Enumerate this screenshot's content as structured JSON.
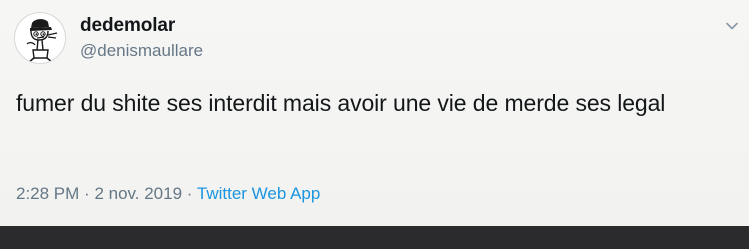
{
  "tweet": {
    "author": {
      "display_name": "dedemolar",
      "handle": "@denismaullare"
    },
    "text": "fumer du shite ses interdit mais avoir une vie de merde ses legal",
    "time": "2:28 PM",
    "separator": "·",
    "date": "2 nov. 2019",
    "source": "Twitter Web App",
    "menu_icon": "chevron-down-icon"
  },
  "colors": {
    "background": "#f4f4f2",
    "text": "#14171a",
    "secondary_text": "#657786",
    "link": "#1b95e0",
    "bottom_bar": "#2b2b2d"
  }
}
